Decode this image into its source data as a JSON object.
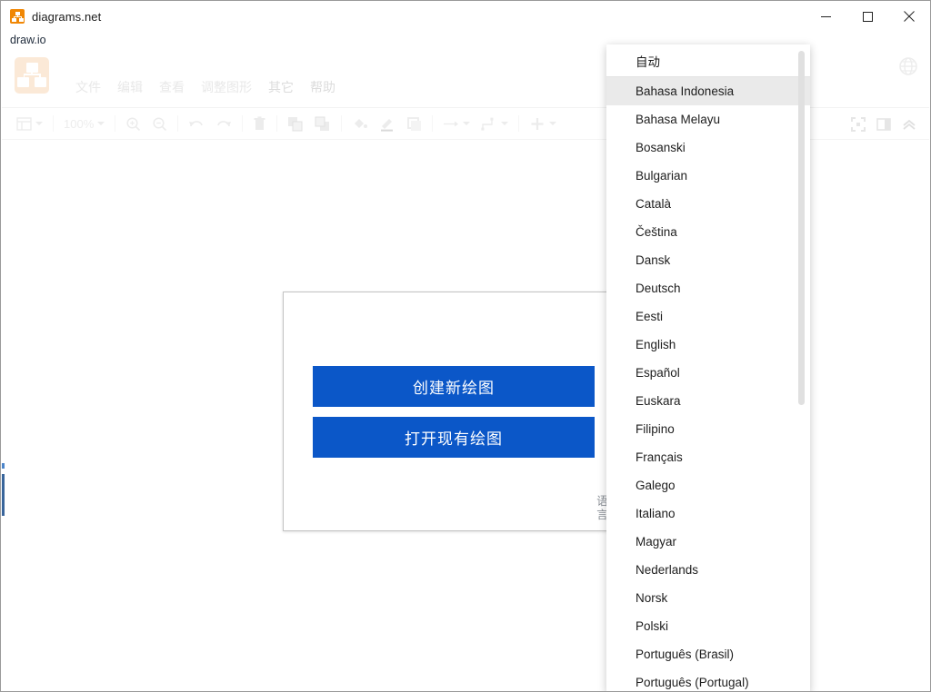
{
  "window": {
    "title": "diagrams.net",
    "subtitle": "draw.io",
    "app_icon": "drawio-logo-icon",
    "controls": [
      {
        "name": "minimize-button",
        "glyph": "minimize-icon"
      },
      {
        "name": "maximize-button",
        "glyph": "maximize-icon"
      },
      {
        "name": "close-button",
        "glyph": "close-icon"
      }
    ]
  },
  "menubar": {
    "items": [
      {
        "label": "文件",
        "name": "menu-file"
      },
      {
        "label": "编辑",
        "name": "menu-edit"
      },
      {
        "label": "查看",
        "name": "menu-view"
      },
      {
        "label": "调整图形",
        "name": "menu-arrange"
      },
      {
        "label": "其它",
        "name": "menu-extras"
      },
      {
        "label": "帮助",
        "name": "menu-help"
      }
    ],
    "language_button": "globe-icon"
  },
  "toolbar": {
    "zoom_level": "100%",
    "icons": [
      "view-layout-icon",
      "zoom-in-icon",
      "zoom-out-icon",
      "undo-icon",
      "redo-icon",
      "delete-icon",
      "to-front-icon",
      "to-back-icon",
      "fill-color-icon",
      "line-color-icon",
      "shadow-icon",
      "connection-icon",
      "waypoints-icon",
      "insert-icon"
    ],
    "right_icons": [
      "fullscreen-icon",
      "toggle-format-panel-icon",
      "collapse-toolbar-icon"
    ]
  },
  "splash": {
    "create_button": "创建新绘图",
    "open_button": "打开现有绘图",
    "language_link": "语言"
  },
  "language_menu": {
    "auto_label": "自动",
    "selected": "Bahasa Indonesia",
    "items": [
      "Bahasa Indonesia",
      "Bahasa Melayu",
      "Bosanski",
      "Bulgarian",
      "Català",
      "Čeština",
      "Dansk",
      "Deutsch",
      "Eesti",
      "English",
      "Español",
      "Euskara",
      "Filipino",
      "Français",
      "Galego",
      "Italiano",
      "Magyar",
      "Nederlands",
      "Norsk",
      "Polski",
      "Português (Brasil)",
      "Português (Portugal)"
    ]
  },
  "colors": {
    "brand_orange": "#f08705",
    "button_blue": "#0b57c8",
    "selected_row": "#eaeaea"
  }
}
